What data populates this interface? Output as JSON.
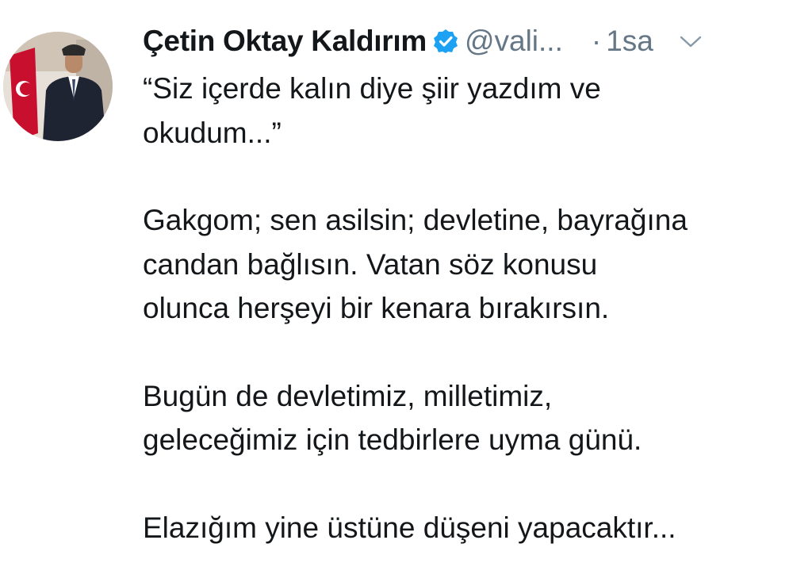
{
  "tweet": {
    "author_name": "Çetin Oktay Kaldırım",
    "handle": "@vali...",
    "separator": "·",
    "time": "1sa",
    "paragraphs": [
      {
        "lines": [
          "“Siz içerde kalın diye şiir yazdım ve",
          "okudum...”"
        ]
      },
      {
        "lines": [
          "Gakgom; sen asilsin; devletine, bayrağına",
          "candan bağlısın. Vatan söz konusu",
          "olunca herşeyi bir kenara bırakırsın."
        ]
      },
      {
        "lines": [
          "Bugün de devletimiz, milletimiz,",
          "geleceğimiz için tedbirlere uyma günü."
        ]
      },
      {
        "lines": [
          "Elazığım yine üstüne düşeni yapacaktır..."
        ]
      }
    ]
  },
  "icons": {
    "verified": "verified-badge-icon",
    "more": "chevron-down-icon"
  },
  "colors": {
    "text": "#14171a",
    "secondary": "#657786",
    "verified": "#1da1f2"
  }
}
